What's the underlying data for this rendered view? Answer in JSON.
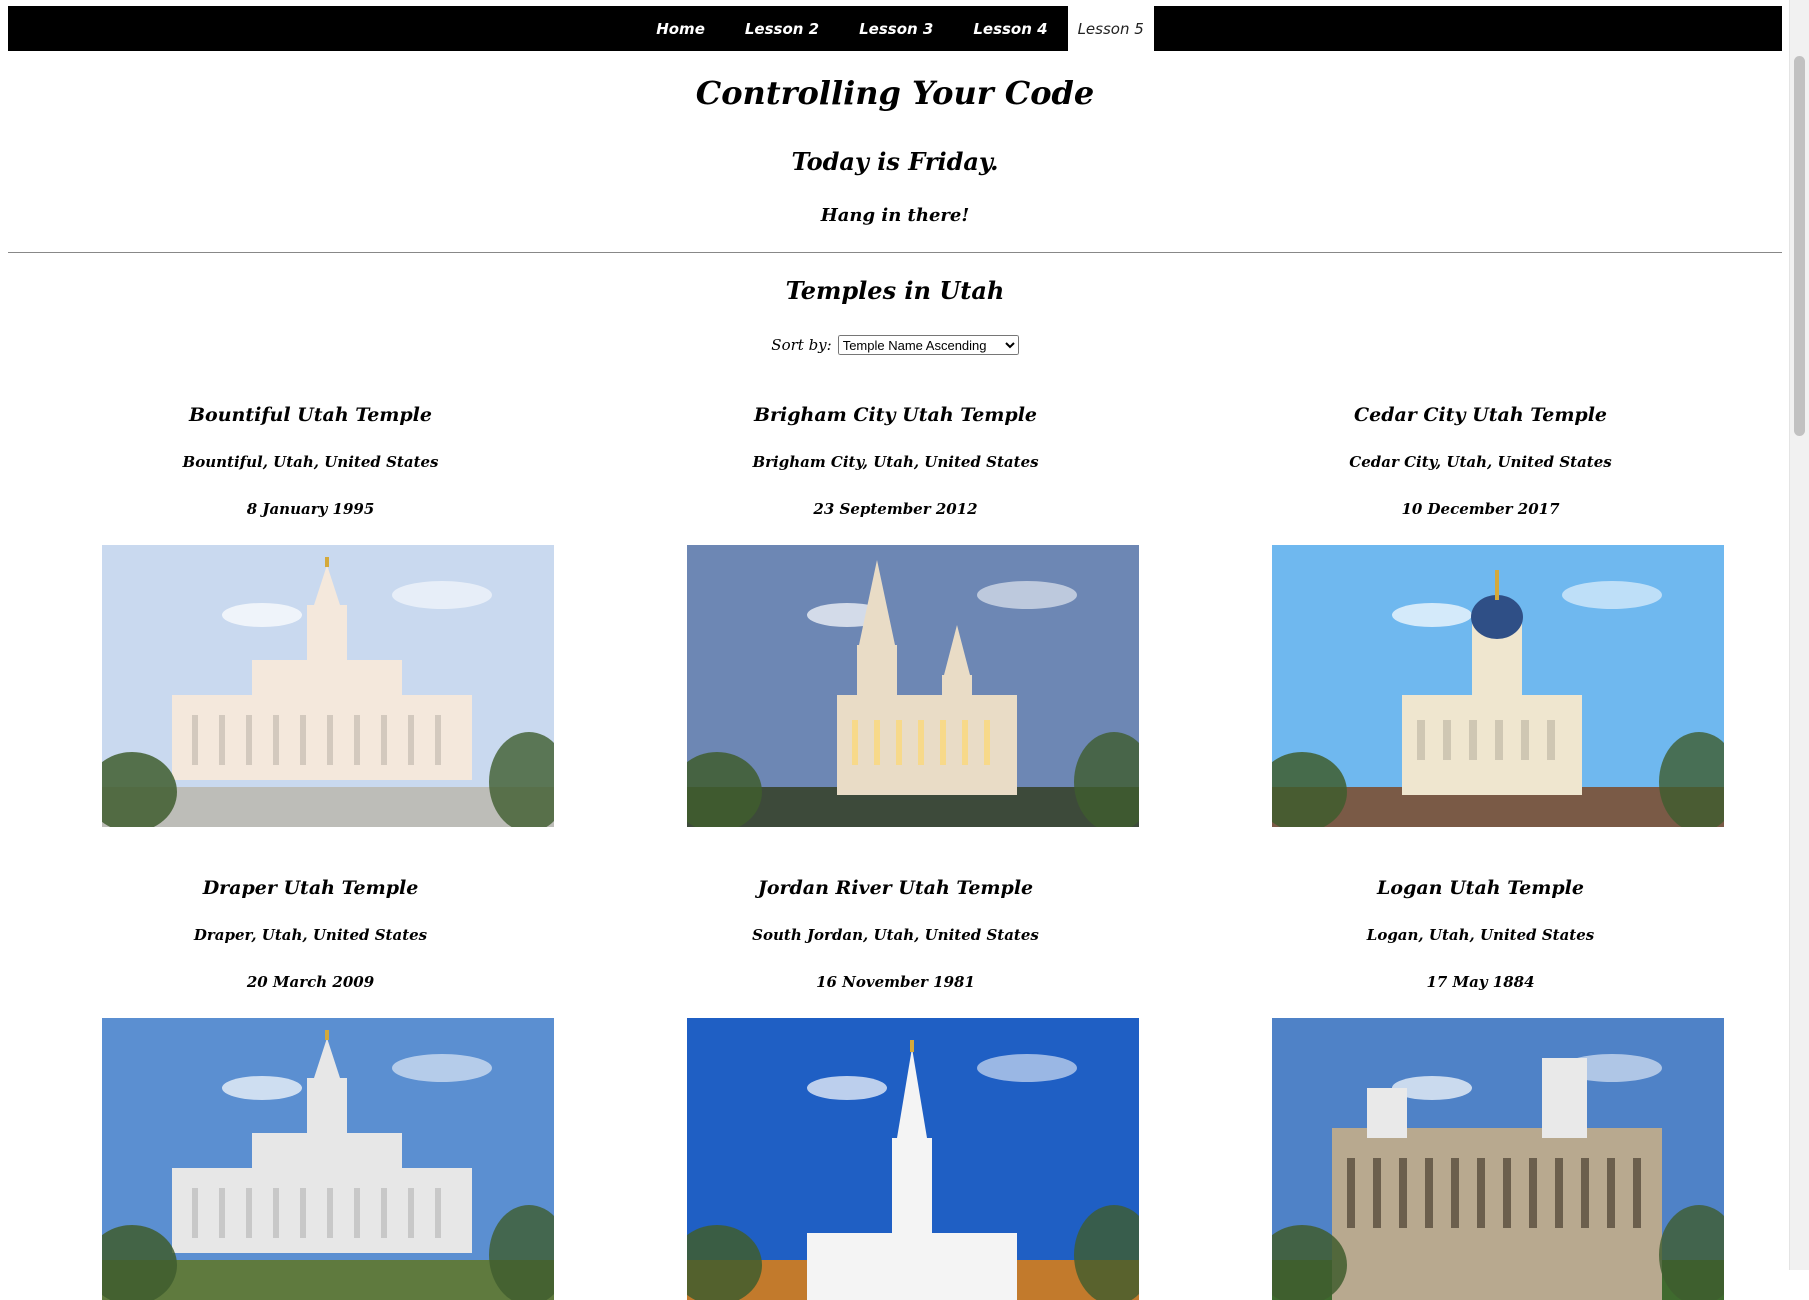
{
  "nav": {
    "items": [
      {
        "label": "Home",
        "active": false
      },
      {
        "label": "Lesson 2",
        "active": false
      },
      {
        "label": "Lesson 3",
        "active": false
      },
      {
        "label": "Lesson 4",
        "active": false
      },
      {
        "label": "Lesson 5",
        "active": true
      }
    ]
  },
  "header": {
    "title": "Controlling Your Code",
    "day_text": "Today is Friday.",
    "message": "Hang in there!"
  },
  "temples_section": {
    "title": "Temples in Utah",
    "sort_label": "Sort by:",
    "sort_selected": "Temple Name Ascending"
  },
  "temples": [
    {
      "name": "Bountiful Utah Temple",
      "location": "Bountiful, Utah, United States",
      "dedicated": "8 January 1995",
      "sky": "#c9d9ef",
      "ground": "#bdbdb8",
      "building": "#f4e8dc",
      "style": "spire"
    },
    {
      "name": "Brigham City Utah Temple",
      "location": "Brigham City, Utah, United States",
      "dedicated": "23 September 2012",
      "sky": "#6d87b4",
      "ground": "#3d4a3a",
      "building": "#e9dcc6",
      "style": "twin"
    },
    {
      "name": "Cedar City Utah Temple",
      "location": "Cedar City, Utah, United States",
      "dedicated": "10 December 2017",
      "sky": "#6fb8ef",
      "ground": "#7a5a46",
      "building": "#efe6cf",
      "style": "dome"
    },
    {
      "name": "Draper Utah Temple",
      "location": "Draper, Utah, United States",
      "dedicated": "20 March 2009",
      "sky": "#5b8fd1",
      "ground": "#5f7a3e",
      "building": "#e7e7e7",
      "style": "spire"
    },
    {
      "name": "Jordan River Utah Temple",
      "location": "South Jordan, Utah, United States",
      "dedicated": "16 November 1981",
      "sky": "#1f5fc4",
      "ground": "#c27a2c",
      "building": "#f4f4f4",
      "style": "tall"
    },
    {
      "name": "Logan Utah Temple",
      "location": "Logan, Utah, United States",
      "dedicated": "17 May 1884",
      "sky": "#4f82c7",
      "ground": "#3f6a2e",
      "building": "#b8a98f",
      "style": "castle"
    }
  ]
}
